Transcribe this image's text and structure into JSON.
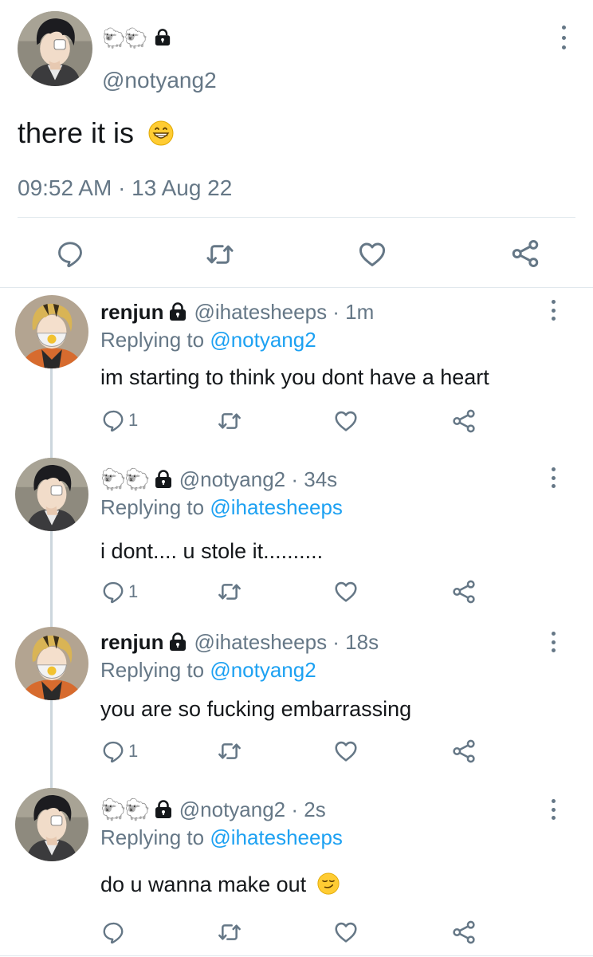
{
  "main_tweet": {
    "display_name": "🐑🐑",
    "handle": "@notyang2",
    "text": "there it is",
    "timestamp": "09:52 AM · 13 Aug 22"
  },
  "replies": [
    {
      "name": "renjun",
      "handle": "@ihatesheeps · 1m",
      "replying_prefix": "Replying to",
      "replying_to": "@notyang2",
      "text": "im starting to think you dont have a heart",
      "reply_count": "1"
    },
    {
      "name": "🐑🐑",
      "handle": "@notyang2 · 34s",
      "replying_prefix": "Replying to",
      "replying_to": "@ihatesheeps",
      "text": "i dont.... u stole it..........",
      "reply_count": "1"
    },
    {
      "name": "renjun",
      "handle": "@ihatesheeps · 18s",
      "replying_prefix": "Replying to",
      "replying_to": "@notyang2",
      "text": "you are so fucking embarrassing",
      "reply_count": "1"
    },
    {
      "name": "🐑🐑",
      "handle": "@notyang2 · 2s",
      "replying_prefix": "Replying to",
      "replying_to": "@ihatesheeps",
      "text": "do u wanna make out",
      "reply_count": ""
    }
  ],
  "icons": [
    "reply-icon",
    "retweet-icon",
    "like-icon",
    "share-icon",
    "lock-icon",
    "more-options-icon"
  ],
  "colors": {
    "accent": "#1da1f2",
    "muted": "#657786",
    "text": "#14171a",
    "divider": "#e1e8ed"
  }
}
